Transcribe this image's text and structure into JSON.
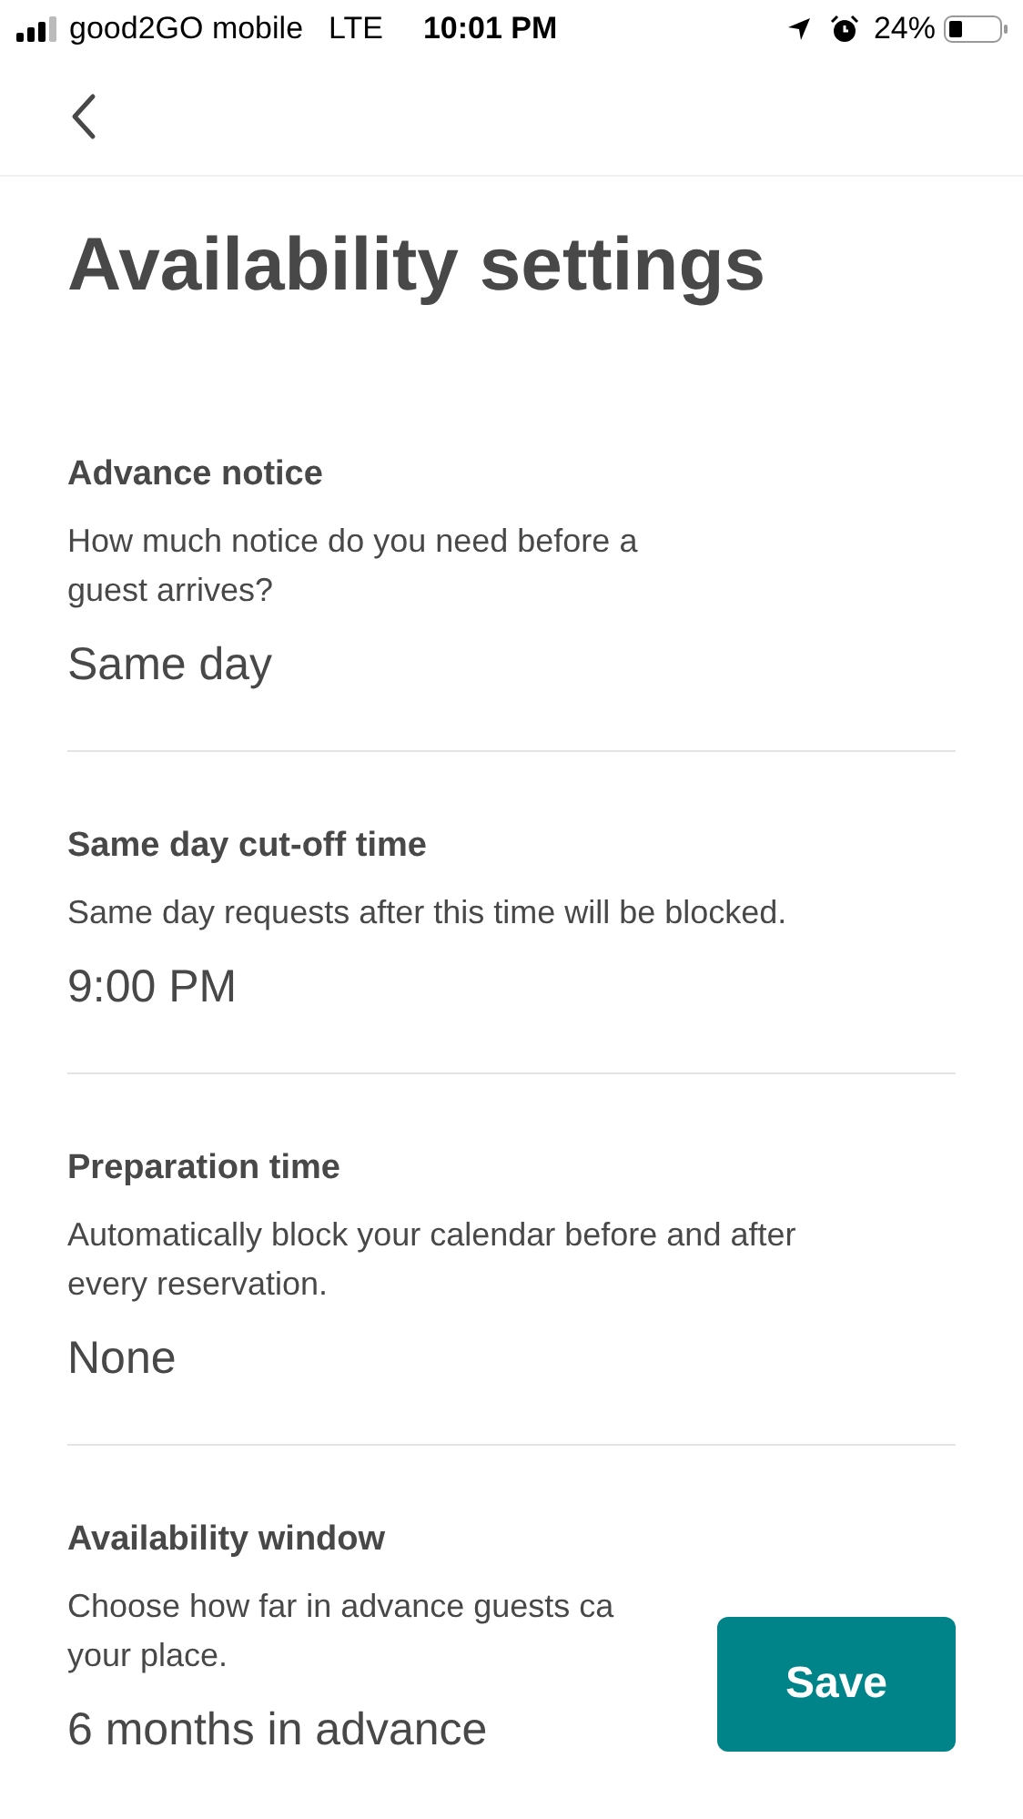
{
  "status_bar": {
    "carrier": "good2GO mobile",
    "network": "LTE",
    "time": "10:01 PM",
    "battery": "24%"
  },
  "title": "Availability settings",
  "sections": [
    {
      "heading": "Advance notice",
      "description_lines": [
        "How much notice do you need before a",
        "guest arrives?"
      ],
      "value": "Same day"
    },
    {
      "heading": "Same day cut-off time",
      "description_lines": [
        "Same day requests after this time will be blocked."
      ],
      "value": "9:00 PM"
    },
    {
      "heading": "Preparation time",
      "description_lines": [
        "Automatically block your calendar before and after",
        "every reservation."
      ],
      "value": "None"
    },
    {
      "heading": "Availability window",
      "description_lines": [
        "Choose how far in advance guests ca",
        "your place."
      ],
      "value": "6 months in advance"
    }
  ],
  "save_button": "Save"
}
